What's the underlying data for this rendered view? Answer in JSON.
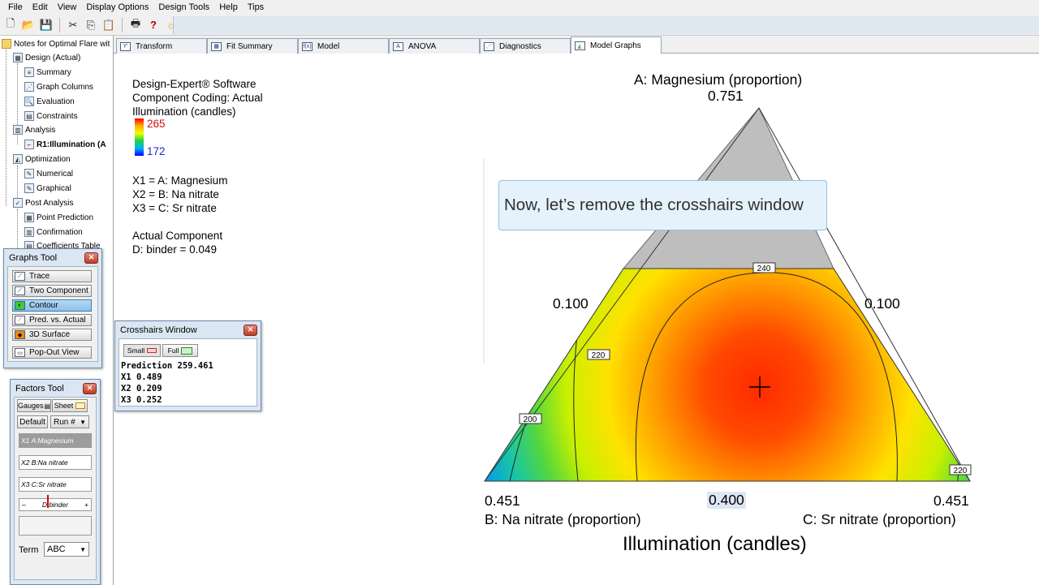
{
  "menu": [
    "File",
    "Edit",
    "View",
    "Display Options",
    "Design Tools",
    "Help",
    "Tips"
  ],
  "toolbar_icons": [
    "new-icon",
    "open-icon",
    "save-icon",
    "cut-icon",
    "copy-icon",
    "paste-icon",
    "print-icon",
    "help-icon",
    "tip-bulb-icon"
  ],
  "tree": {
    "root": "Notes for Optimal Flare wit",
    "design": "Design (Actual)",
    "summary": "Summary",
    "graph_columns": "Graph Columns",
    "evaluation": "Evaluation",
    "constraints": "Constraints",
    "analysis": "Analysis",
    "r1": "R1:Illumination (A",
    "optimization": "Optimization",
    "numerical": "Numerical",
    "graphical": "Graphical",
    "post_analysis": "Post Analysis",
    "point_prediction": "Point Prediction",
    "confirmation": "Confirmation",
    "coefficients_table": "Coefficients Table"
  },
  "tabs": [
    {
      "label": "Transform",
      "icon": "Y'"
    },
    {
      "label": "Fit Summary",
      "icon": "▦"
    },
    {
      "label": "Model",
      "icon": "f(x)"
    },
    {
      "label": "ANOVA",
      "icon": "A"
    },
    {
      "label": "Diagnostics",
      "icon": "⋰"
    },
    {
      "label": "Model Graphs",
      "icon": "◭"
    }
  ],
  "info": {
    "software": "Design-Expert® Software",
    "coding": "Component Coding: Actual",
    "response": "Illumination (candles)",
    "legend_high": "265",
    "legend_low": "172",
    "x1": "X1 = A: Magnesium",
    "x2": "X2 = B: Na nitrate",
    "x3": "X3 = C: Sr nitrate",
    "actual_component": "Actual Component",
    "binder": "D: binder = 0.049"
  },
  "plot": {
    "top_label": "A: Magnesium (proportion)",
    "top_value": "0.751",
    "left_side_value": "0.100",
    "right_side_value": "0.100",
    "bottom_left_value": "0.451",
    "bottom_center_value": "0.400",
    "bottom_right_value": "0.451",
    "left_axis_label": "B: Na nitrate (proportion)",
    "right_axis_label": "C: Sr nitrate (proportion)",
    "title": "Illumination (candles)",
    "contour_labels": [
      "240",
      "220",
      "200",
      "220"
    ]
  },
  "callout": "Now, let’s remove the crosshairs window",
  "graphs_tool": {
    "title": "Graphs Tool",
    "buttons": [
      "Trace",
      "Two Component",
      "Contour",
      "Pred. vs. Actual",
      "3D Surface",
      "Pop-Out View"
    ],
    "active": "Contour"
  },
  "factors_tool": {
    "title": "Factors Tool",
    "tab_gauges": "Gauges",
    "tab_sheet": "Sheet",
    "default_btn": "Default",
    "run_select": "Run #",
    "rows": [
      "X1 A:Magnesium",
      "X2 B:Na nitrate",
      "X3 C:Sr nitrate"
    ],
    "slider_label": "D:binder",
    "slider_minus": "–",
    "slider_plus": "+",
    "term_label": "Term",
    "term_value": "ABC"
  },
  "crosshairs": {
    "title": "Crosshairs Window",
    "small_btn": "Small",
    "full_btn": "Full",
    "prediction": "Prediction 259.461",
    "x1": "X1 0.489",
    "x2": "X2 0.209",
    "x3": "X3 0.252"
  },
  "colors": {
    "callout_bg": "#e6f2fb",
    "callout_border": "#8fc1e3",
    "legend_high": "#d01010",
    "legend_low": "#1a2fd0",
    "constraint_gray": "#bebebe"
  }
}
